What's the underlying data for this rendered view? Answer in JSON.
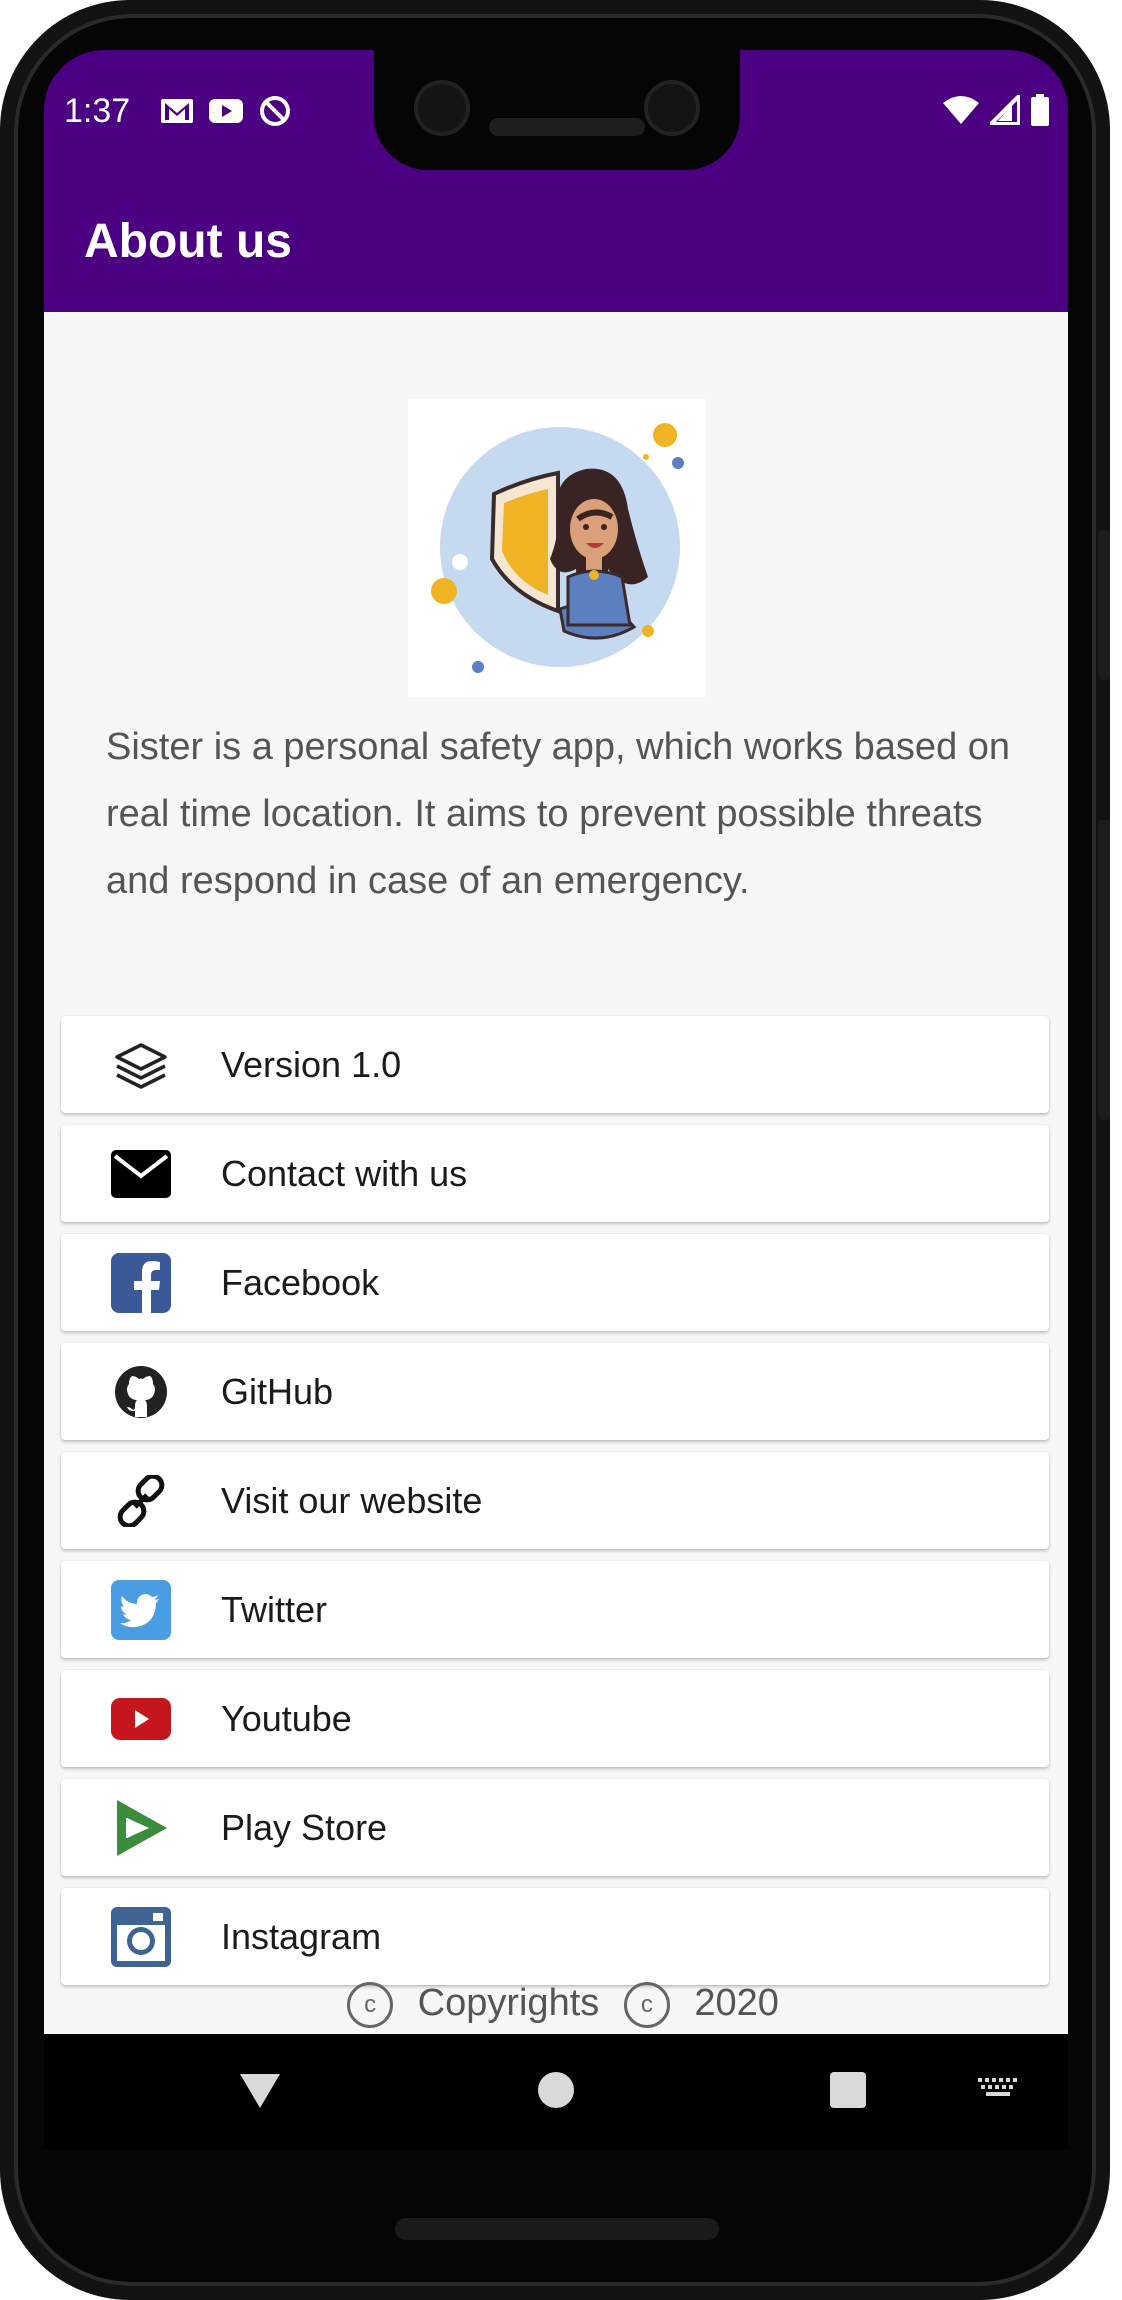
{
  "status_bar": {
    "time": "1:37",
    "left_icons": [
      "gmail-icon",
      "youtube-icon",
      "data-saver-icon"
    ],
    "right_icons": [
      "wifi-icon",
      "signal-icon",
      "battery-icon"
    ]
  },
  "app_bar": {
    "title": "About us",
    "color": "#4b0082"
  },
  "about": {
    "description": "Sister is a personal safety app, which works based on real time location. It aims to prevent possible threats and respond in case of an emergency."
  },
  "items": [
    {
      "label": "Version 1.0",
      "icon": "layers-icon"
    },
    {
      "label": "Contact with us",
      "icon": "mail-icon"
    },
    {
      "label": "Facebook",
      "icon": "facebook-icon",
      "color": "#3b5998"
    },
    {
      "label": "GitHub",
      "icon": "github-icon"
    },
    {
      "label": "Visit our website",
      "icon": "link-icon"
    },
    {
      "label": "Twitter",
      "icon": "twitter-icon",
      "color": "#4a9de2"
    },
    {
      "label": "Youtube",
      "icon": "youtube-icon",
      "color": "#c4161c"
    },
    {
      "label": "Play Store",
      "icon": "play-store-icon",
      "color": "#3b8d3b"
    },
    {
      "label": "Instagram",
      "icon": "instagram-icon",
      "color": "#3f6493"
    }
  ],
  "footer": {
    "text": "Copyrights",
    "year": "2020"
  },
  "nav": {
    "icons": [
      "back-icon",
      "home-icon",
      "recents-icon",
      "keyboard-icon"
    ]
  }
}
